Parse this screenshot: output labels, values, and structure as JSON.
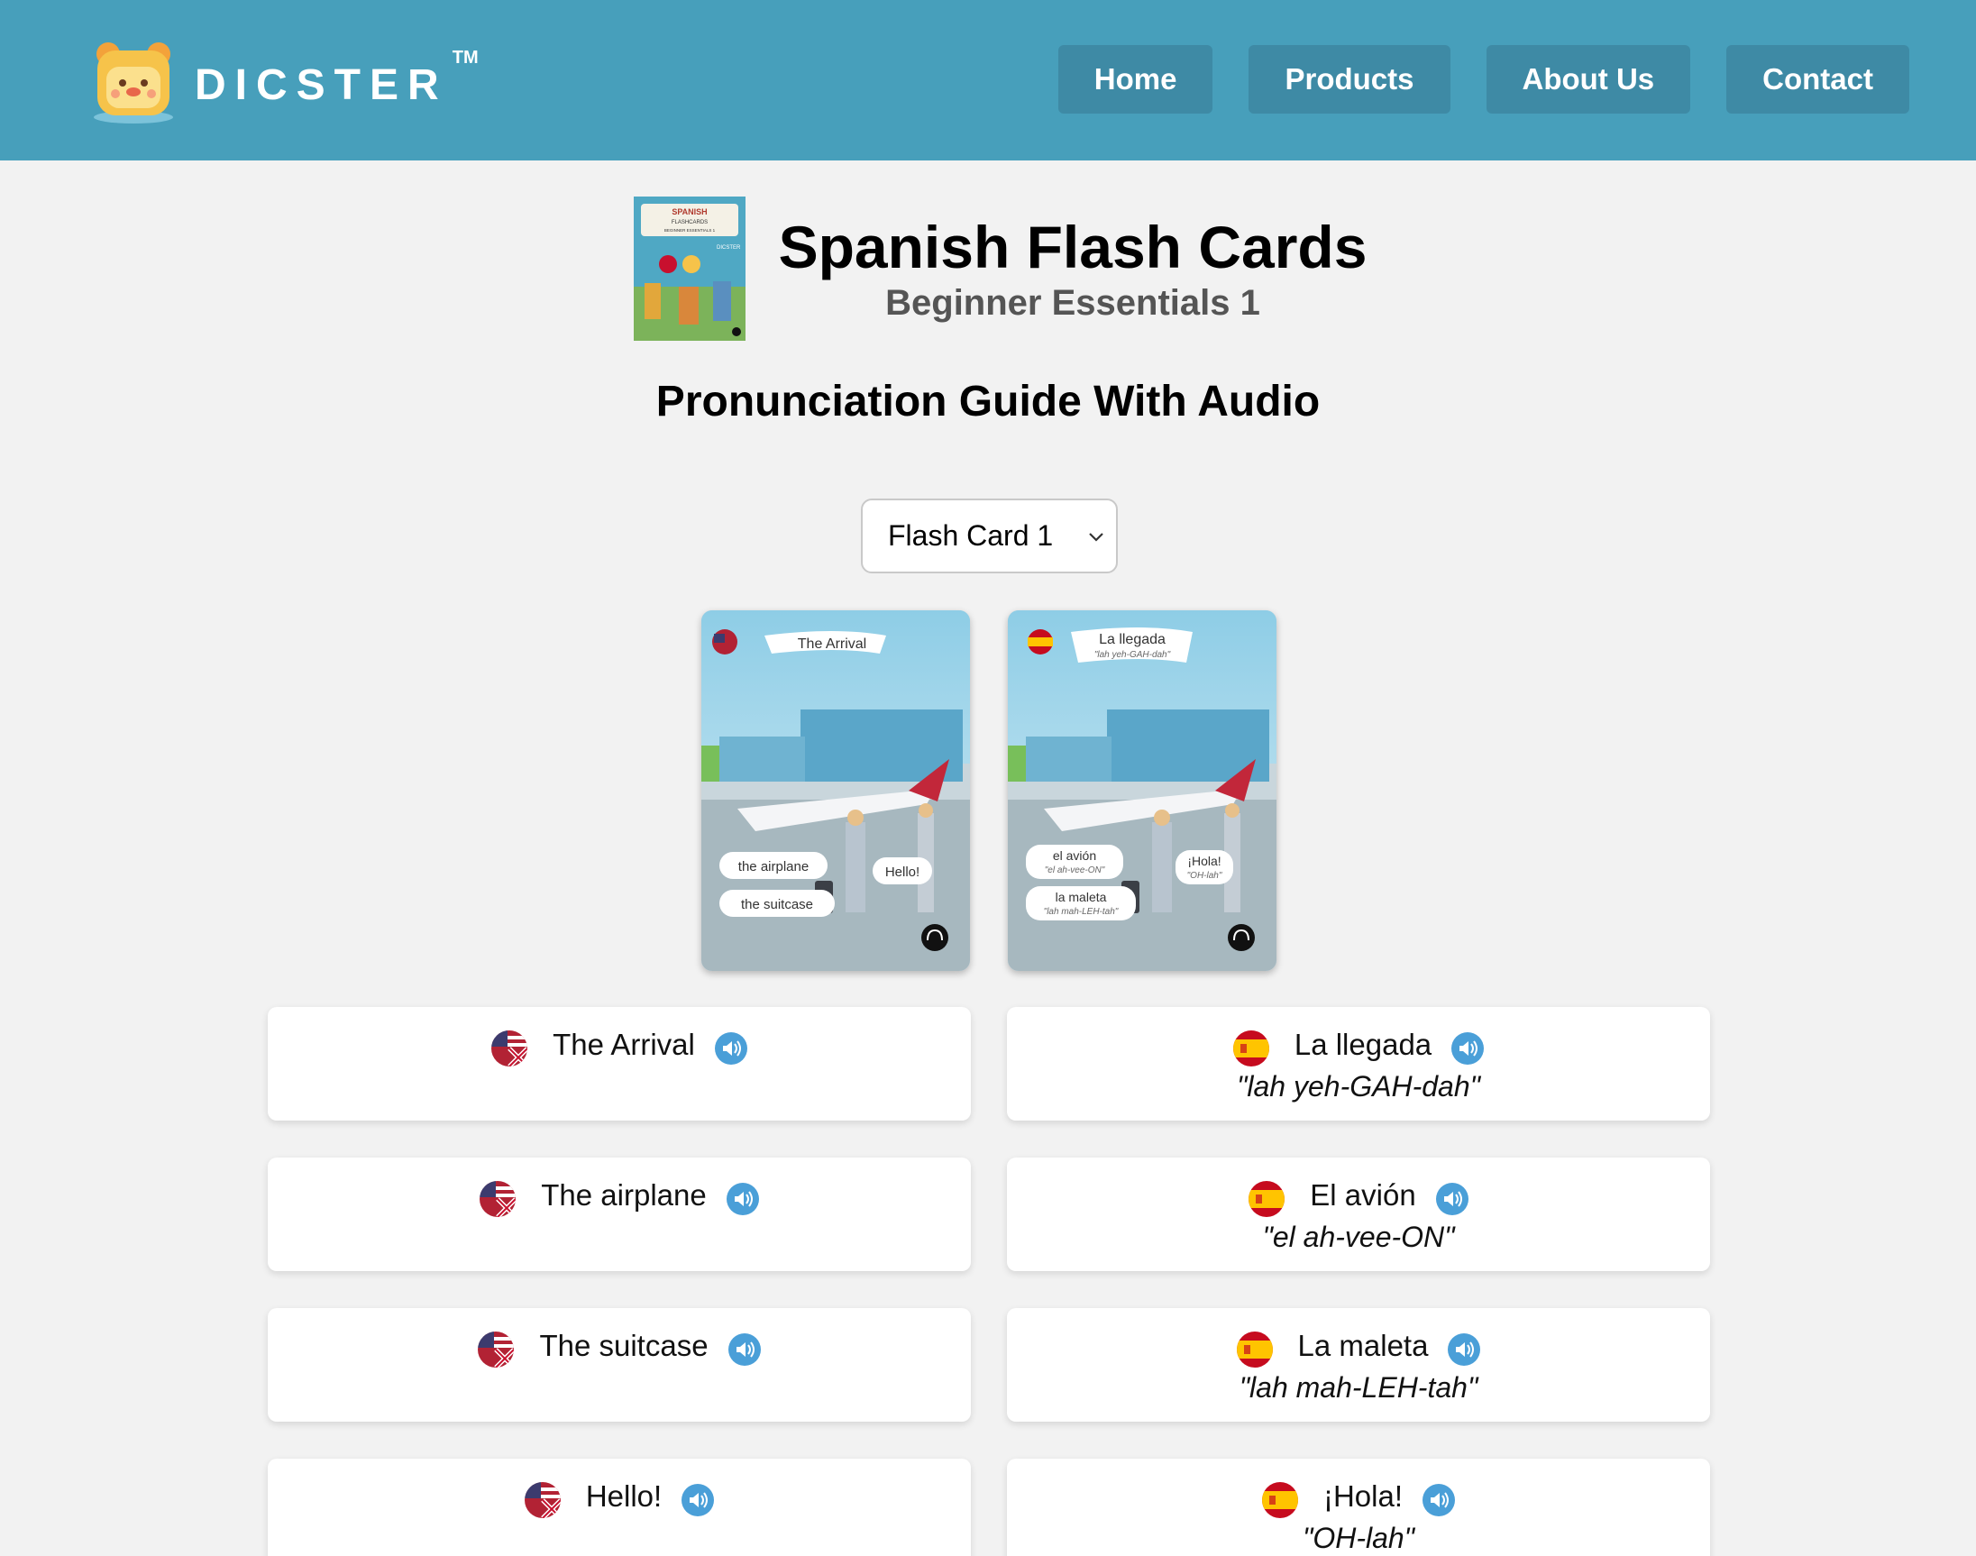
{
  "brand": {
    "name": "DICSTER",
    "tm": "TM"
  },
  "nav": {
    "items": [
      {
        "label": "Home"
      },
      {
        "label": "Products"
      },
      {
        "label": "About Us"
      },
      {
        "label": "Contact"
      }
    ]
  },
  "product": {
    "title": "Spanish Flash Cards",
    "subtitle": "Beginner Essentials 1",
    "cover_text": {
      "line1": "SPANISH",
      "line2": "FLASHCARDS",
      "line3": "BEGINNER ESSENTIALS 1",
      "brand": "DICSTER"
    }
  },
  "guide_title": "Pronunciation Guide With Audio",
  "card_select": {
    "selected": "Flash Card 1"
  },
  "card_en": {
    "banner": "The Arrival",
    "labels": [
      "the airplane",
      "the suitcase",
      "Hello!"
    ]
  },
  "card_es": {
    "banner": "La llegada",
    "banner_pron": "\"lah yeh-GAH-dah\"",
    "labels": [
      {
        "word": "el avión",
        "pron": "\"el ah-vee-ON\""
      },
      {
        "word": "la maleta",
        "pron": "\"lah mah-LEH-tah\""
      },
      {
        "word": "¡Hola!",
        "pron": "\"OH-lah\""
      }
    ]
  },
  "phrases_en": [
    {
      "word": "The Arrival"
    },
    {
      "word": "The airplane"
    },
    {
      "word": "The suitcase"
    },
    {
      "word": "Hello!"
    }
  ],
  "phrases_es": [
    {
      "word": "La llegada",
      "pron": "\"lah yeh-GAH-dah\""
    },
    {
      "word": "El avión",
      "pron": "\"el ah-vee-ON\""
    },
    {
      "word": "La maleta",
      "pron": "\"lah mah-LEH-tah\""
    },
    {
      "word": "¡Hola!",
      "pron": "\"OH-lah\""
    }
  ],
  "colors": {
    "header": "#479fbb",
    "nav_button": "#3e8aa5",
    "speaker": "#4a9fd8",
    "background": "#f2f2f2"
  },
  "icons": {
    "speaker": "speaker-icon",
    "flag_en": "us-uk-flag-icon",
    "flag_es": "spain-flag-icon",
    "logo": "bear-logo-icon"
  }
}
